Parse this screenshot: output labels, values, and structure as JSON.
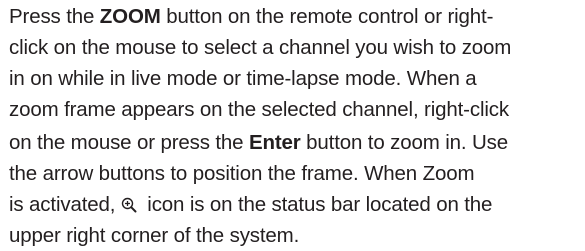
{
  "paragraph": {
    "line1": {
      "pre": "Press the ",
      "bold": "ZOOM",
      "post": " button on the remote control or right-"
    },
    "line2": "click on the mouse to select a channel you wish to zoom",
    "line3": "in on while in live mode or time-lapse mode. When a",
    "line4": "zoom frame appears on the selected channel, right-click",
    "line5": {
      "pre": "on the mouse or press the ",
      "bold": "Enter",
      "post": " button to zoom in. Use"
    },
    "line6": "the arrow buttons to position the frame. When Zoom",
    "line7": {
      "pre": "is activated,",
      "icon": "zoom-in-icon",
      "post": "icon is on the status bar located on the"
    },
    "line8": "upper right corner of the system."
  }
}
